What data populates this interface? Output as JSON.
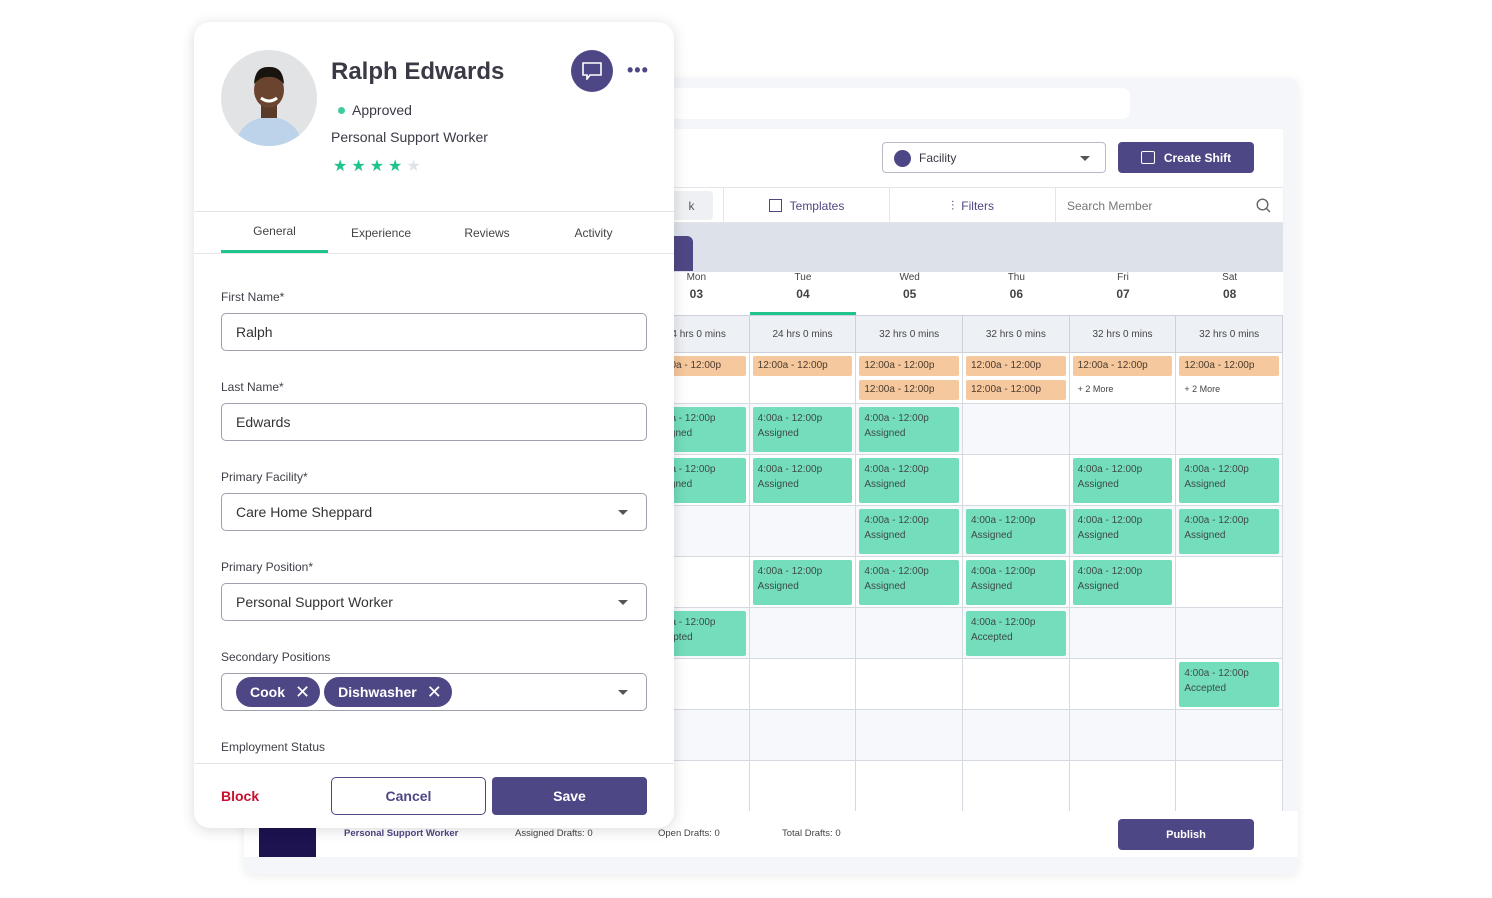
{
  "colors": {
    "brand": "#4e4785",
    "accent_green": "#1fc48a",
    "shift_assigned": "#73ddbc",
    "shift_open": "#f5c89d",
    "danger": "#c8102e"
  },
  "scheduler": {
    "facility_placeholder": "Facility",
    "facility_icon": "building-icon",
    "create_shift_label": "Create Shift",
    "partial_tab_text": "k",
    "templates_label": "Templates",
    "filters_label": "Filters",
    "search_placeholder": "Search Member",
    "days": [
      {
        "name": "Mon",
        "date": "03",
        "hours": "24 hrs 0 mins"
      },
      {
        "name": "Tue",
        "date": "04",
        "hours": "24 hrs 0 mins",
        "selected": true
      },
      {
        "name": "Wed",
        "date": "05",
        "hours": "32 hrs 0 mins"
      },
      {
        "name": "Thu",
        "date": "06",
        "hours": "32 hrs 0 mins"
      },
      {
        "name": "Fri",
        "date": "07",
        "hours": "32 hrs 0 mins"
      },
      {
        "name": "Sat",
        "date": "08",
        "hours": "32 hrs 0 mins"
      }
    ],
    "open_shifts": [
      {
        "shifts": [
          "12:00a - 12:00p"
        ],
        "more": ""
      },
      {
        "shifts": [
          "12:00a - 12:00p"
        ],
        "more": ""
      },
      {
        "shifts": [
          "12:00a - 12:00p",
          "12:00a - 12:00p"
        ],
        "more": ""
      },
      {
        "shifts": [
          "12:00a - 12:00p",
          "12:00a - 12:00p"
        ],
        "more": ""
      },
      {
        "shifts": [
          "12:00a - 12:00p"
        ],
        "more": "+ 2 More"
      },
      {
        "shifts": [
          "12:00a - 12:00p"
        ],
        "more": "+ 2 More"
      }
    ],
    "shift_time": "4:00a - 12:00p",
    "rows": [
      [
        "Assigned",
        "Assigned",
        "Assigned",
        "",
        "",
        ""
      ],
      [
        "Assigned",
        "Assigned",
        "Assigned",
        "",
        "Assigned",
        "Assigned"
      ],
      [
        "",
        "",
        "Assigned",
        "Assigned",
        "Assigned",
        "Assigned"
      ],
      [
        "",
        "Assigned",
        "Assigned",
        "Assigned",
        "Assigned",
        ""
      ],
      [
        "Accepted",
        "",
        "",
        "Accepted",
        "",
        ""
      ],
      [
        "",
        "",
        "",
        "",
        "",
        "Accepted"
      ],
      [
        "",
        "",
        "",
        "",
        "",
        ""
      ],
      [
        "",
        "",
        "",
        "",
        "",
        ""
      ]
    ],
    "footer": {
      "position": "Personal Support Worker",
      "assigned_drafts": "Assigned Drafts:  0",
      "open_drafts": "Open Drafts:  0",
      "total_drafts": "Total Drafts:  0",
      "publish_label": "Publish"
    }
  },
  "profile": {
    "name": "Ralph Edwards",
    "status": "Approved",
    "position": "Personal Support Worker",
    "rating": 4,
    "rating_max": 5,
    "tabs": [
      {
        "label": "General",
        "active": true
      },
      {
        "label": "Experience"
      },
      {
        "label": "Reviews"
      },
      {
        "label": "Activity"
      }
    ],
    "first_name_label": "First Name*",
    "first_name": "Ralph",
    "last_name_label": "Last Name*",
    "last_name": "Edwards",
    "facility_label": "Primary Facility*",
    "facility": "Care Home Sheppard",
    "primary_position_label": "Primary Position*",
    "primary_position": "Personal Support Worker",
    "secondary_label": "Secondary Positions",
    "secondary": [
      "Cook",
      "Dishwasher"
    ],
    "employment_label": "Employment Status",
    "block_label": "Block",
    "cancel_label": "Cancel",
    "save_label": "Save"
  }
}
